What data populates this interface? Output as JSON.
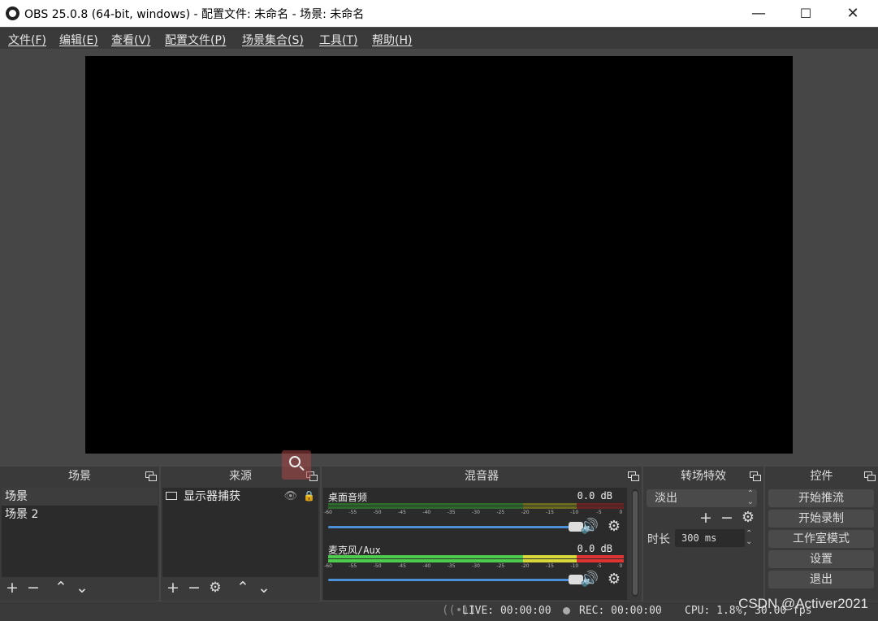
{
  "window": {
    "title": "OBS 25.0.8 (64-bit, windows) - 配置文件: 未命名 - 场景: 未命名",
    "minimize": "—",
    "maximize": "☐",
    "close": "✕"
  },
  "menu": [
    "文件(F)",
    "编辑(E)",
    "查看(V)",
    "配置文件(P)",
    "场景集合(S)",
    "工具(T)",
    "帮助(H)"
  ],
  "scenes": {
    "title": "场景",
    "items": [
      "场景",
      "场景 2"
    ],
    "selected": 0
  },
  "sources": {
    "title": "来源",
    "items": [
      {
        "label": "显示器捕获",
        "icon": "monitor-icon"
      }
    ]
  },
  "mixer": {
    "title": "混音器",
    "channels": [
      {
        "name": "桌面音频",
        "db": "0.0 dB",
        "level": 0,
        "volume": 1.0
      },
      {
        "name": "麦克风/Aux",
        "db": "0.0 dB",
        "level": 1.0,
        "volume": 1.0
      }
    ],
    "ticks": [
      "-60",
      "-55",
      "-50",
      "-45",
      "-40",
      "-35",
      "-30",
      "-25",
      "-20",
      "-15",
      "-10",
      "-5",
      "0"
    ]
  },
  "transitions": {
    "title": "转场特效",
    "selected": "淡出",
    "duration_label": "时长",
    "duration_value": "300 ms"
  },
  "controls": {
    "title": "控件",
    "buttons": [
      "开始推流",
      "开始录制",
      "工作室模式",
      "设置",
      "退出"
    ]
  },
  "status": {
    "live": "LIVE: 00:00:00",
    "rec": "REC: 00:00:00",
    "cpu": "CPU: 1.8%, 30.00 fps"
  },
  "watermark": "CSDN @Activer2021",
  "colors": {
    "meter_green": "#4ccb4c",
    "meter_yellow": "#d8d83a",
    "meter_red": "#dd3333",
    "slider_blue": "#4d8fd8"
  }
}
